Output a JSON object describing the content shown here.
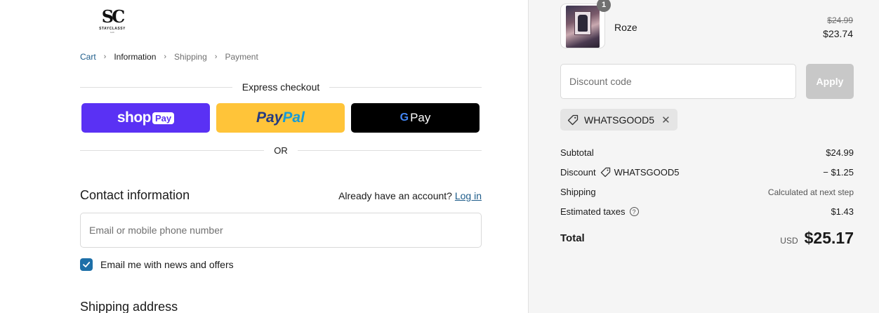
{
  "logo": {
    "mark": "SC",
    "brand": "STAYCLASSY",
    "brand_sub": "LLC"
  },
  "breadcrumb": {
    "items": [
      {
        "label": "Cart"
      },
      {
        "label": "Information"
      },
      {
        "label": "Shipping"
      },
      {
        "label": "Payment"
      }
    ],
    "current": "Information"
  },
  "express_checkout": {
    "title": "Express checkout",
    "shop_label": "shop",
    "shop_pill": "Pay",
    "paypal_part1": "Pay",
    "paypal_part2": "Pal",
    "gpay_g": "G",
    "gpay_label": "Pay",
    "or_label": "OR"
  },
  "contact": {
    "title": "Contact information",
    "account_prompt": "Already have an account?",
    "login_label": "Log in",
    "email_placeholder": "Email or mobile phone number",
    "newsletter_label": "Email me with news and offers",
    "newsletter_checked": true
  },
  "shipping": {
    "title": "Shipping address"
  },
  "order": {
    "item": {
      "name": "Roze",
      "quantity": "1",
      "original_price": "$24.99",
      "price": "$23.74"
    },
    "discount_placeholder": "Discount code",
    "apply_label": "Apply",
    "applied_code": "WHATSGOOD5",
    "subtotal_label": "Subtotal",
    "subtotal_value": "$24.99",
    "discount_label": "Discount",
    "discount_code": "WHATSGOOD5",
    "discount_value": "− $1.25",
    "shipping_label": "Shipping",
    "shipping_value": "Calculated at next step",
    "taxes_label": "Estimated taxes",
    "taxes_value": "$1.43",
    "total_label": "Total",
    "currency": "USD",
    "total_value": "$25.17"
  },
  "colors": {
    "shop_pay": "#5a31f4",
    "paypal": "#ffc439",
    "gpay": "#000000",
    "link": "#1d5c8a",
    "checkbox": "#1d6fa8",
    "sidebar_bg": "#f5f5f5"
  },
  "icons": [
    "tag-icon",
    "close-icon",
    "help-icon",
    "check-icon",
    "chevron-right-icon"
  ]
}
